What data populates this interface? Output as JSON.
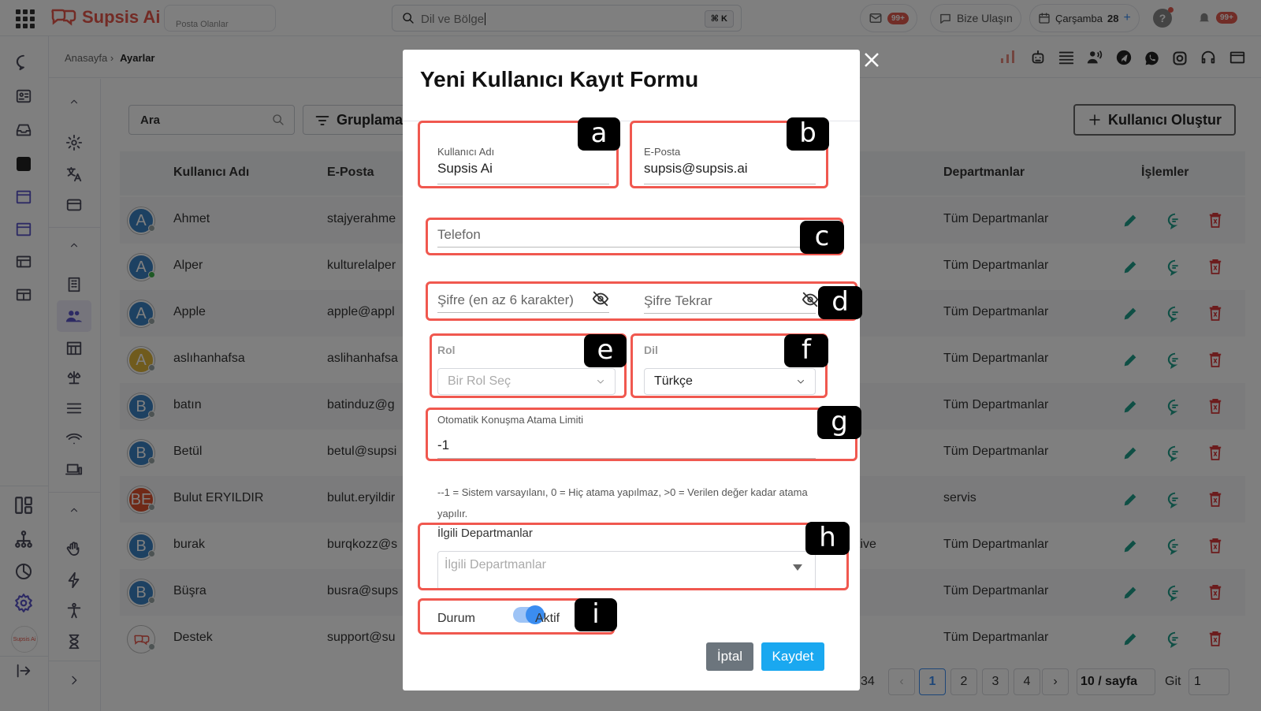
{
  "topbar": {
    "logo_text": "Supsis Ai",
    "workspace_label": "Posta Olanlar",
    "search_value": "Dil ve Bölge",
    "search_shortcut": "⌘ K",
    "mail_badge": "99+",
    "contact_label": "Bize Ulaşın",
    "date_label": "Çarşamba",
    "date_day": "28",
    "date_add": "+",
    "notif_badge": "99+"
  },
  "breadcrumb": {
    "home": "Anasayfa ›",
    "current": "Ayarlar"
  },
  "toolbar": {
    "search_placeholder": "Ara",
    "group_label": "Gruplama",
    "create_label": "Kullanıcı Oluştur"
  },
  "table": {
    "headers": {
      "username": "Kullanıcı Adı",
      "email": "E-Posta",
      "departments": "Departmanlar",
      "actions": "İşlemler"
    },
    "rows": [
      {
        "initial": "A",
        "name": "Ahmet",
        "email": "stajyerahme",
        "extra": "",
        "dept": "Tüm Departmanlar",
        "avatar_color": "#3b82c4",
        "status_color": "#9aa6a6"
      },
      {
        "initial": "A",
        "name": "Alper",
        "email": "kulturelalper",
        "extra": "",
        "dept": "Tüm Departmanlar",
        "avatar_color": "#3b82c4",
        "status_color": "#3cb34a"
      },
      {
        "initial": "A",
        "name": "Apple",
        "email": "apple@appl",
        "extra": "",
        "dept": "Tüm Departmanlar",
        "avatar_color": "#3b82c4",
        "status_color": "#9aa6a6"
      },
      {
        "initial": "A",
        "name": "aslıhanhafsa",
        "email": "aslihanhafsa",
        "extra": "",
        "dept": "Tüm Departmanlar",
        "avatar_color": "#e0b63a",
        "status_color": "#9aa6a6"
      },
      {
        "initial": "B",
        "name": "batın",
        "email": "batinduz@g",
        "extra": "",
        "dept": "Tüm Departmanlar",
        "avatar_color": "#3b82c4",
        "status_color": "#9aa6a6"
      },
      {
        "initial": "B",
        "name": "Betül",
        "email": "betul@supsi",
        "extra": "",
        "dept": "Tüm Departmanlar",
        "avatar_color": "#3b82c4",
        "status_color": "#9aa6a6"
      },
      {
        "initial": "BE",
        "name": "Bulut ERYILDIR",
        "email": "bulut.eryildir",
        "extra": "",
        "dept": "servis",
        "avatar_color": "#e0522e",
        "status_color": "#9aa6a6"
      },
      {
        "initial": "B",
        "name": "burak",
        "email": "burqkozz@s",
        "extra": "tive",
        "dept": "Tüm Departmanlar",
        "avatar_color": "#3b82c4",
        "status_color": "#9aa6a6"
      },
      {
        "initial": "B",
        "name": "Büşra",
        "email": "busra@sups",
        "extra": "",
        "dept": "Tüm Departmanlar",
        "avatar_color": "#3b82c4",
        "status_color": "#9aa6a6"
      },
      {
        "initial": "",
        "name": "Destek",
        "email": "support@su",
        "extra": "",
        "dept": "Tüm Departmanlar",
        "avatar_color": "#ffffff",
        "status_color": "#9aa6a6"
      }
    ]
  },
  "pagination": {
    "total_suffix": "34",
    "prev": "‹",
    "pages": [
      "1",
      "2",
      "3",
      "4"
    ],
    "next": "›",
    "per_page": "10 / sayfa",
    "goto_label": "Git",
    "goto_value": "1"
  },
  "modal": {
    "title": "Yeni Kullanıcı Kayıt Formu",
    "username_label": "Kullanıcı Adı",
    "username_value": "Supsis Ai",
    "email_label": "E-Posta",
    "email_value": "supsis@supsis.ai",
    "phone_placeholder": "Telefon",
    "password_placeholder": "Şifre (en az 6 karakter)",
    "password_repeat_placeholder": "Şifre Tekrar",
    "role_label": "Rol",
    "role_placeholder": "Bir Rol Seç",
    "language_label": "Dil",
    "language_value": "Türkçe",
    "limit_label": "Otomatik Konuşma Atama Limiti",
    "limit_value": "-1",
    "limit_help": "--1 = Sistem varsayılanı, 0 = Hiç atama yapılmaz, >0 = Verilen değer kadar atama yapılır.",
    "departments_label": "İlgili Departmanlar",
    "departments_placeholder": "İlgili Departmanlar",
    "status_label": "Durum",
    "status_value": "Aktif",
    "status_on": 1,
    "cancel_label": "İptal",
    "save_label": "Kaydet"
  },
  "annotations": [
    "a",
    "b",
    "c",
    "d",
    "e",
    "f",
    "g",
    "h",
    "i"
  ],
  "colors": {
    "accent": "#3b8df0",
    "annotation": "#f0584f",
    "save": "#1aa8f0",
    "cancel": "#6c757d",
    "edit": "#1f9e8a",
    "delete": "#d9383a",
    "brand": "#e6574b"
  },
  "icons": [
    "grid-icon",
    "search-icon",
    "mail-icon",
    "chat-icon",
    "calendar-icon",
    "help-icon",
    "bell-icon",
    "pencil-icon",
    "message-icon",
    "trash-icon",
    "eye-off-icon",
    "chevron-down-icon",
    "close-icon",
    "plus-icon",
    "filter-icon"
  ]
}
